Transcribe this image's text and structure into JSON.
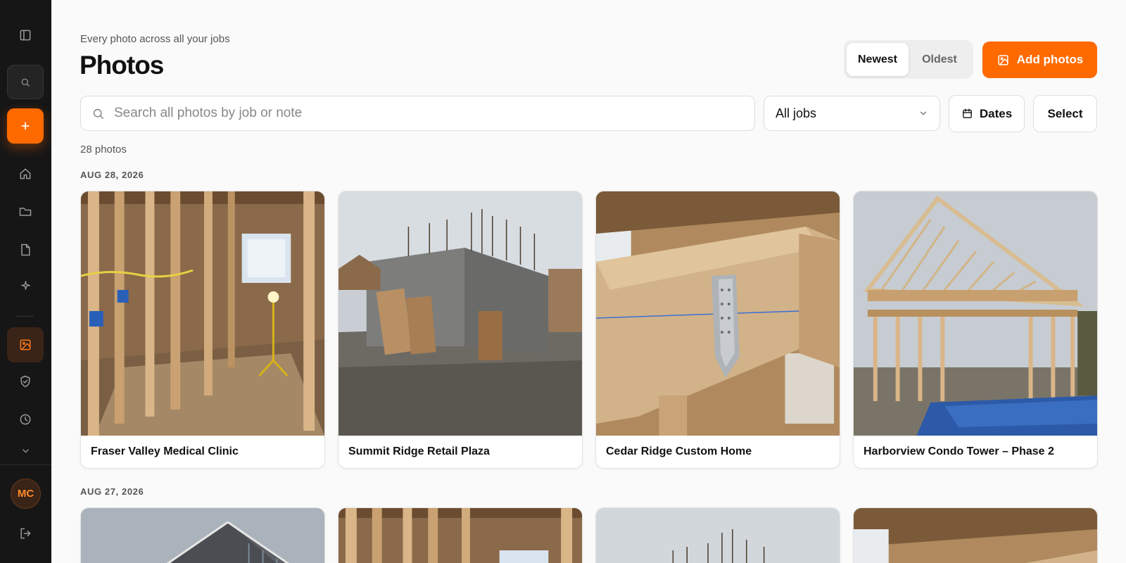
{
  "header": {
    "eyebrow": "Every photo across all your jobs",
    "title": "Photos"
  },
  "sort": {
    "options": [
      "Newest",
      "Oldest"
    ],
    "selected": "Newest"
  },
  "actions": {
    "add_photos": "Add photos",
    "dates": "Dates",
    "select": "Select"
  },
  "search": {
    "placeholder": "Search all photos by job or note",
    "value": ""
  },
  "filter": {
    "jobs": "All jobs"
  },
  "summary": {
    "count": "28 photos"
  },
  "groups": [
    {
      "date": "AUG 28, 2026",
      "photos": [
        {
          "job": "Fraser Valley Medical Clinic",
          "scene": "interior-framing"
        },
        {
          "job": "Summit Ridge Retail Plaza",
          "scene": "concrete-foundation"
        },
        {
          "job": "Cedar Ridge Custom Home",
          "scene": "beam-hanger"
        },
        {
          "job": "Harborview Condo Tower – Phase 2",
          "scene": "roof-trusses"
        }
      ]
    },
    {
      "date": "AUG 27, 2026",
      "photos": [
        {
          "job": "",
          "scene": "house-exterior"
        },
        {
          "job": "",
          "scene": "interior-framing"
        },
        {
          "job": "",
          "scene": "concrete-foundation"
        },
        {
          "job": "",
          "scene": "beam-hanger"
        }
      ]
    }
  ],
  "user": {
    "initials": "MC"
  },
  "icons": [
    "sidebar-toggle-icon",
    "search-icon",
    "plus-icon",
    "home-icon",
    "folder-icon",
    "file-icon",
    "sparkle-icon",
    "image-icon",
    "shield-icon",
    "clock-icon",
    "chevron-down-icon",
    "logout-icon",
    "calendar-icon"
  ],
  "colors": {
    "accent": "#ff6a00",
    "sidebar": "#161616",
    "background": "#fafafa"
  }
}
